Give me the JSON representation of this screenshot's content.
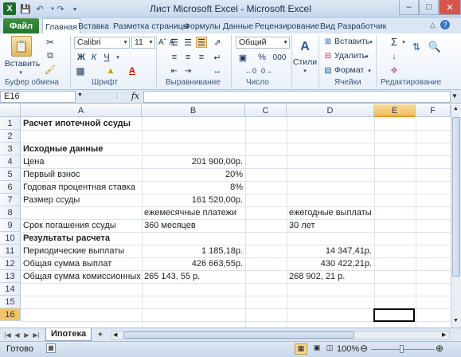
{
  "window": {
    "title": "Лист Microsoft Excel - Microsoft Excel"
  },
  "tabs": {
    "file": "Файл",
    "items": [
      "Главная",
      "Вставка",
      "Разметка страницы",
      "Формулы",
      "Данные",
      "Рецензирование",
      "Вид",
      "Разработчик"
    ]
  },
  "ribbon": {
    "clipboard": {
      "paste": "Вставить",
      "group": "Буфер обмена"
    },
    "font": {
      "name": "Calibri",
      "size": "11",
      "group": "Шрифт",
      "bold": "Ж",
      "italic": "К",
      "underline": "Ч"
    },
    "alignment": {
      "group": "Выравнивание"
    },
    "number": {
      "format": "Общий",
      "group": "Число",
      "percent": "%",
      "thousands": "000"
    },
    "styles": {
      "label": "Стили"
    },
    "cells": {
      "insert": "Вставить",
      "delete": "Удалить",
      "format": "Формат",
      "group": "Ячейки"
    },
    "editing": {
      "group": "Редактирование"
    }
  },
  "formula_bar": {
    "name_box": "E16",
    "fx": "fx",
    "formula": ""
  },
  "sheet": {
    "columns": [
      "A",
      "B",
      "C",
      "D",
      "E",
      "F"
    ],
    "rows": [
      "1",
      "2",
      "3",
      "4",
      "5",
      "6",
      "7",
      "8",
      "9",
      "10",
      "11",
      "12",
      "13",
      "14",
      "15",
      "16"
    ],
    "cells": {
      "A1": "Расчет ипотечной ссуды",
      "A3": "Исходные данные",
      "A4": "Цена",
      "B4": "201 900,00р.",
      "A5": "Первый взнос",
      "B5": "20%",
      "A6": "Годовая процентная ставка",
      "B6": "8%",
      "A7": "Размер ссуды",
      "B7": "161 520,00р.",
      "B8": "ежемесячные платежи",
      "D8": "ежегодные выплаты",
      "A9": "Срок погашения ссуды",
      "B9": "360 месяцев",
      "D9": "30 лет",
      "A10": "Результаты расчета",
      "A11": "Периодические выплаты",
      "B11": "1 185,18р.",
      "D11": "14 347,41р.",
      "A12": "Общая сумма выплат",
      "B12": "426 663,55р.",
      "D12": "430 422,21р.",
      "A13": "Общая сумма комиссионных",
      "B13": "265 143, 55 р.",
      "D13": "268 902, 21 р."
    },
    "selected_cell": "E16",
    "sheet_tab": "Ипотека"
  },
  "status": {
    "ready": "Готово",
    "zoom": "100%"
  },
  "colors": {
    "file_tab": "#2a7d2e",
    "selection_header": "#f1c15f",
    "ribbon_bg": "#e9f0f9"
  }
}
